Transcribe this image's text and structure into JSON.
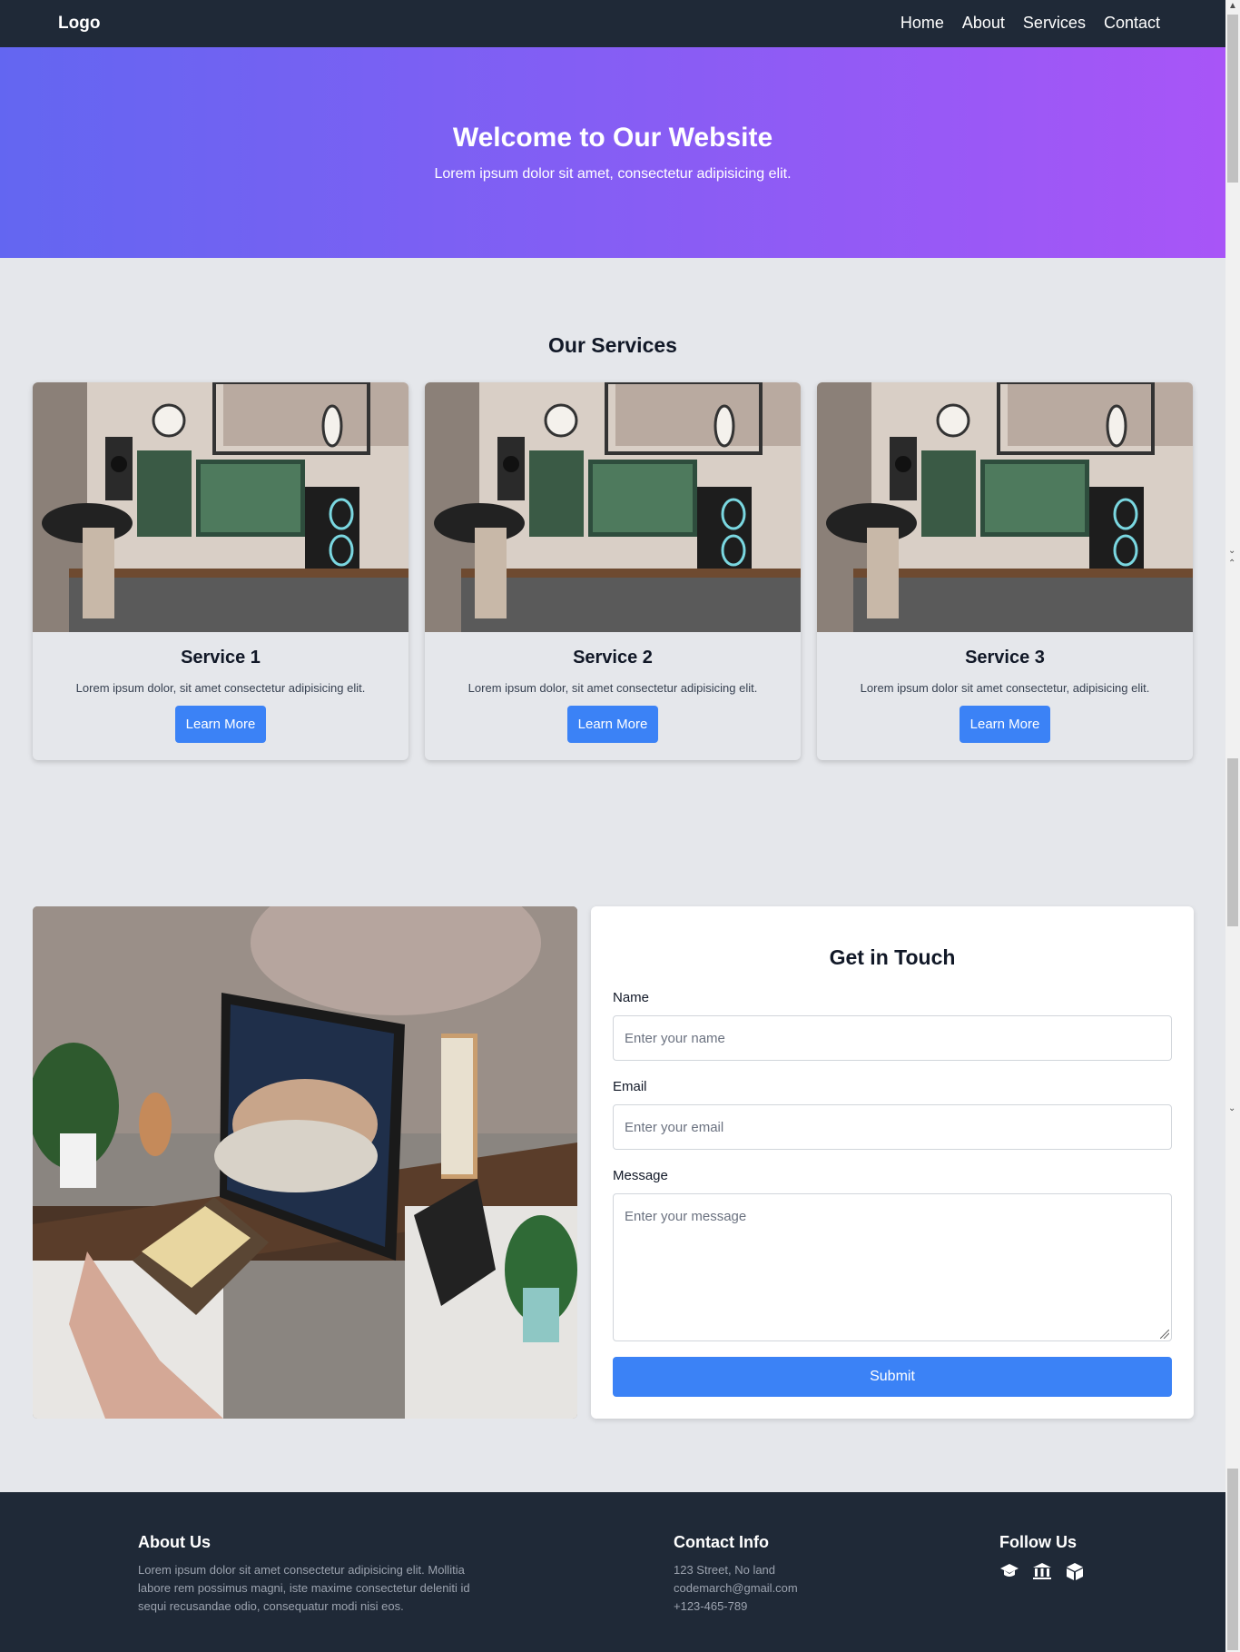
{
  "nav": {
    "logo": "Logo",
    "items": [
      "Home",
      "About",
      "Services",
      "Contact"
    ]
  },
  "hero": {
    "title": "Welcome to Our Website",
    "subtitle": "Lorem ipsum dolor sit amet, consectetur adipisicing elit."
  },
  "services": {
    "title": "Our Services",
    "cards": [
      {
        "title": "Service 1",
        "text": "Lorem ipsum dolor, sit amet consectetur adipisicing elit.",
        "button": "Learn More"
      },
      {
        "title": "Service 2",
        "text": "Lorem ipsum dolor, sit amet consectetur adipisicing elit.",
        "button": "Learn More"
      },
      {
        "title": "Service 3",
        "text": "Lorem ipsum dolor sit amet consectetur, adipisicing elit.",
        "button": "Learn More"
      }
    ]
  },
  "contact": {
    "title": "Get in Touch",
    "name_label": "Name",
    "name_placeholder": "Enter your name",
    "email_label": "Email",
    "email_placeholder": "Enter your email",
    "message_label": "Message",
    "message_placeholder": "Enter your message",
    "submit": "Submit"
  },
  "footer": {
    "about_title": "About Us",
    "about_text": "Lorem ipsum dolor sit amet consectetur adipisicing elit. Mollitia labore rem possimus magni, iste maxime consectetur deleniti id sequi recusandae odio, consequatur modi nisi eos.",
    "contact_title": "Contact Info",
    "address": "123 Street, No land",
    "email": "codemarch@gmail.com",
    "phone": "+123-465-789",
    "follow_title": "Follow Us",
    "social_icons": [
      "graduation-cap-icon",
      "bank-icon",
      "cube-icon"
    ]
  },
  "colors": {
    "nav_bg": "#1f2937",
    "hero_start": "#6366f1",
    "hero_end": "#a855f7",
    "accent": "#3b82f6",
    "page_bg": "#e5e7eb"
  }
}
